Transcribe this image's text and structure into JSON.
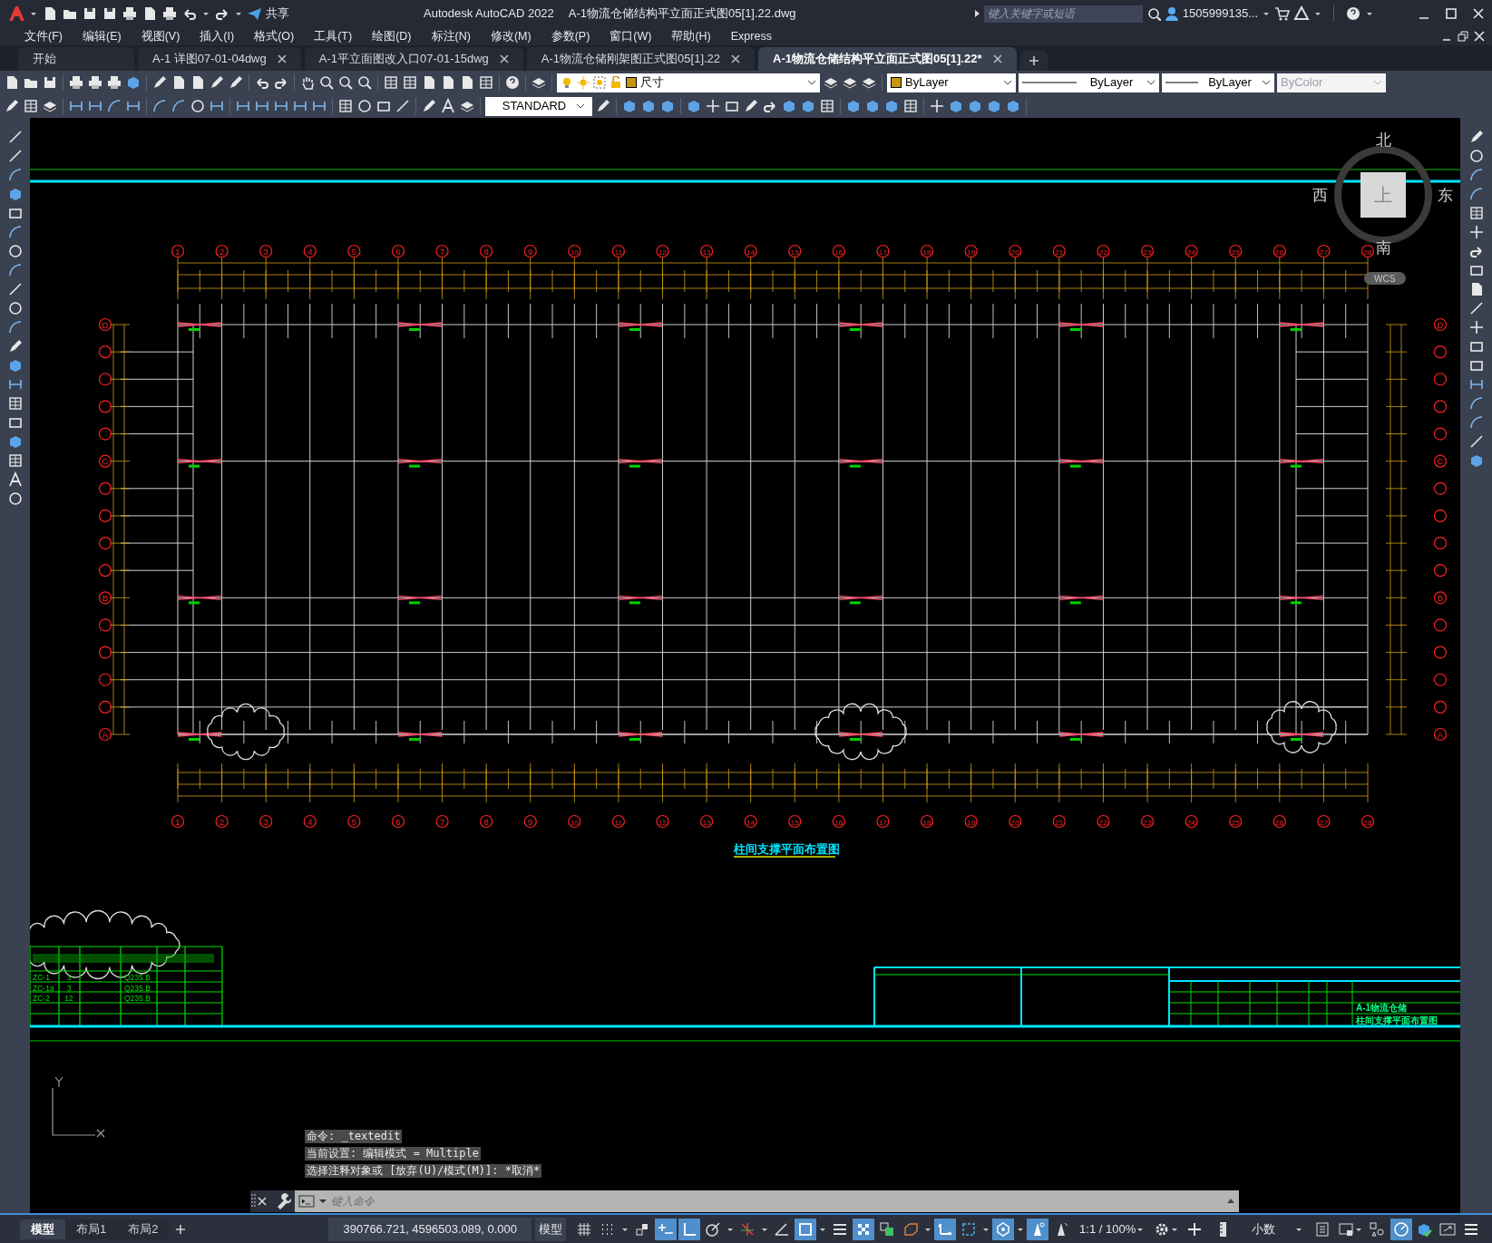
{
  "window": {
    "app": "Autodesk AutoCAD 2022",
    "title": "A-1物流仓储结构平立面正式图05[1].22.dwg"
  },
  "quick_access": {
    "share": "共享"
  },
  "search": {
    "placeholder": "键入关键字或短语"
  },
  "user": "1505999135...",
  "menu": [
    "文件(F)",
    "编辑(E)",
    "视图(V)",
    "插入(I)",
    "格式(O)",
    "工具(T)",
    "绘图(D)",
    "标注(N)",
    "修改(M)",
    "参数(P)",
    "窗口(W)",
    "帮助(H)",
    "Express"
  ],
  "file_tabs": [
    {
      "label": "开始",
      "selected": false
    },
    {
      "label": "A-1 详图07-01-04dwg",
      "selected": false
    },
    {
      "label": "A-1平立面图改入口07-01-15dwg",
      "selected": false
    },
    {
      "label": "A-1物流仓储刚架图正式图05[1].22",
      "selected": false
    },
    {
      "label": "A-1物流仓储结构平立面正式图05[1].22*",
      "selected": true
    }
  ],
  "properties": {
    "layer": "尺寸",
    "color_setting": "ByLayer",
    "linetype": "ByLayer",
    "lineweight": "ByLayer",
    "plotstyle": {
      "value": "ByColor",
      "disabled": true
    }
  },
  "text_style": "STANDARD",
  "viewcube": {
    "north": "北",
    "south": "南",
    "east": "东",
    "west": "西",
    "face": "上",
    "ucs": "WCS"
  },
  "drawing": {
    "top_axes": [
      "1",
      "2",
      "3",
      "4",
      "5",
      "6",
      "7",
      "8",
      "9",
      "10",
      "11",
      "12",
      "13",
      "14",
      "15",
      "16",
      "17",
      "18",
      "19",
      "20",
      "21",
      "22",
      "23",
      "24",
      "25",
      "26",
      "27",
      "28"
    ],
    "bottom_axes": [
      "1",
      "2",
      "3",
      "4",
      "5",
      "6",
      "7",
      "8",
      "9",
      "10",
      "11",
      "12",
      "13",
      "14",
      "15",
      "16",
      "17",
      "18",
      "19",
      "20",
      "21",
      "22",
      "23",
      "24",
      "25",
      "26",
      "27",
      "28"
    ],
    "left_row_axes": [
      "D",
      "C",
      "B",
      "A"
    ],
    "right_row_axes": [
      "D",
      "C",
      "B",
      "A"
    ],
    "title": "柱间支撑平面布置图"
  },
  "schedule": {
    "rows": [
      [
        "ZC-1",
        "3",
        "Q235.B"
      ],
      [
        "ZC-1a",
        "3",
        "Q235.B"
      ],
      [
        "ZC-2",
        "12",
        "Q235.B"
      ]
    ]
  },
  "title_block": {
    "project": "A-1物流仓储",
    "drawing_name": "柱间支撑平面布置图"
  },
  "command": {
    "history": [
      "命令: _textedit",
      "当前设置: 编辑模式 = Multiple",
      "选择注释对象或 [放弃(U)/模式(M)]: *取消*"
    ],
    "placeholder": "键入命令"
  },
  "layout_tabs": [
    {
      "label": "模型",
      "selected": true
    },
    {
      "label": "布局1",
      "selected": false
    },
    {
      "label": "布局2",
      "selected": false
    }
  ],
  "status_bar": {
    "coordinates": "390766.721, 4596503.089, 0.000",
    "space": "模型",
    "toggles": [
      {
        "kind": "grid",
        "on": false
      },
      {
        "kind": "snap",
        "on": false
      },
      {
        "kind": "infer",
        "on": false
      },
      {
        "kind": "dyninput",
        "on": true
      },
      {
        "kind": "ortho",
        "on": true
      },
      {
        "kind": "polar",
        "on": false
      },
      {
        "kind": "isodraft",
        "on": false
      },
      {
        "kind": "angle",
        "on": false
      },
      {
        "kind": "osnap",
        "on": true
      },
      {
        "kind": "lineweight",
        "on": false
      },
      {
        "kind": "transparency",
        "on": true
      },
      {
        "kind": "cycling",
        "on": false
      },
      {
        "kind": "osnap3d",
        "on": false
      },
      {
        "kind": "ucs",
        "on": true
      },
      {
        "kind": "filter",
        "on": false
      },
      {
        "kind": "gizmo",
        "on": true
      },
      {
        "kind": "annovis",
        "on": true
      },
      {
        "kind": "autoscale",
        "on": false
      }
    ],
    "scale": "1:1 / 100%",
    "units": "小数"
  }
}
